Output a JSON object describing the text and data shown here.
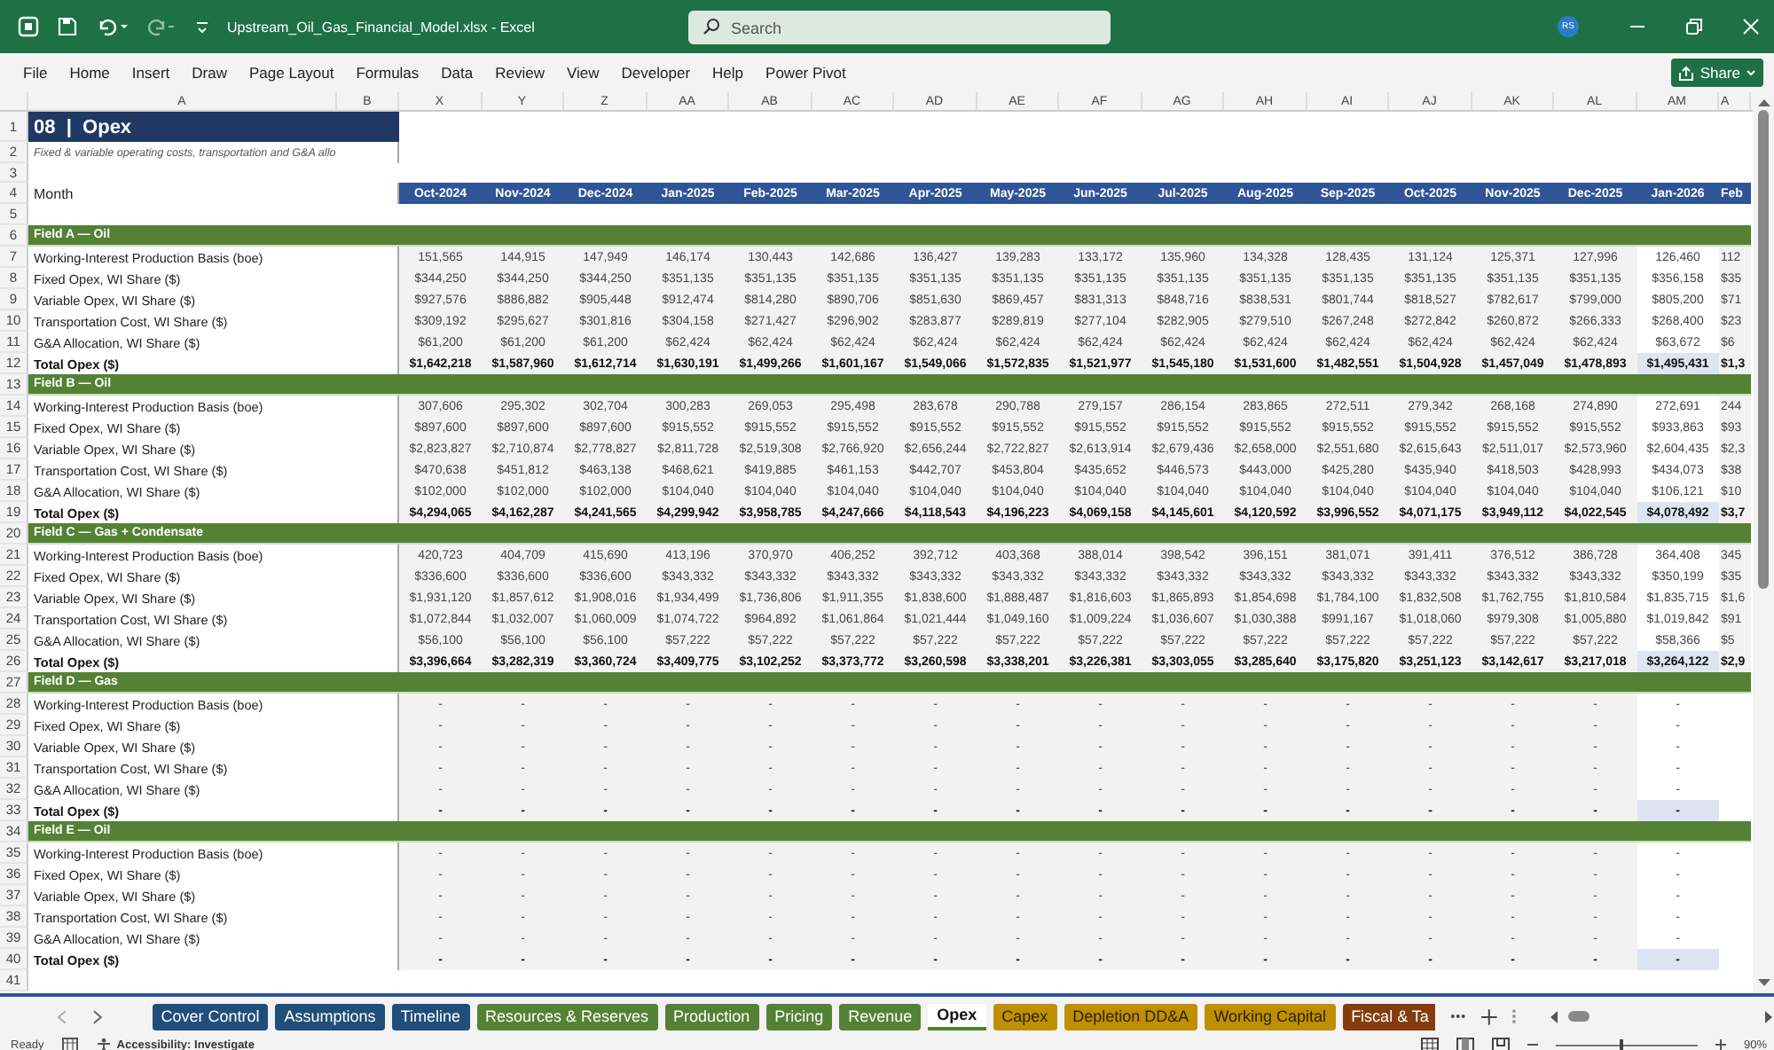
{
  "window": {
    "title": "Upstream_Oil_Gas_Financial_Model.xlsx  -  Excel",
    "search_placeholder": "Search",
    "avatar": "RS"
  },
  "menu": [
    {
      "label": "File"
    },
    {
      "label": "Home"
    },
    {
      "label": "Insert"
    },
    {
      "label": "Draw"
    },
    {
      "label": "Page Layout"
    },
    {
      "label": "Formulas"
    },
    {
      "label": "Data"
    },
    {
      "label": "Review"
    },
    {
      "label": "View"
    },
    {
      "label": "Developer"
    },
    {
      "label": "Help"
    },
    {
      "label": "Power Pivot"
    }
  ],
  "share": "Share",
  "fixed_columns": [
    "A",
    "B"
  ],
  "columns": [
    {
      "letter": "X",
      "month": "Oct-2024",
      "selected": false
    },
    {
      "letter": "Y",
      "month": "Nov-2024",
      "selected": false
    },
    {
      "letter": "Z",
      "month": "Dec-2024",
      "selected": false
    },
    {
      "letter": "AA",
      "month": "Jan-2025",
      "selected": false
    },
    {
      "letter": "AB",
      "month": "Feb-2025",
      "selected": false
    },
    {
      "letter": "AC",
      "month": "Mar-2025",
      "selected": false
    },
    {
      "letter": "AD",
      "month": "Apr-2025",
      "selected": false
    },
    {
      "letter": "AE",
      "month": "May-2025",
      "selected": false
    },
    {
      "letter": "AF",
      "month": "Jun-2025",
      "selected": false
    },
    {
      "letter": "AG",
      "month": "Jul-2025",
      "selected": false
    },
    {
      "letter": "AH",
      "month": "Aug-2025",
      "selected": false
    },
    {
      "letter": "AI",
      "month": "Sep-2025",
      "selected": false
    },
    {
      "letter": "AJ",
      "month": "Oct-2025",
      "selected": false
    },
    {
      "letter": "AK",
      "month": "Nov-2025",
      "selected": false
    },
    {
      "letter": "AL",
      "month": "Dec-2025",
      "selected": false
    },
    {
      "letter": "AM",
      "month": "Jan-2026",
      "selected": true
    },
    {
      "letter": "A",
      "month": "Feb",
      "selected": false
    }
  ],
  "rows": [
    {
      "number": "1",
      "kind": "title",
      "label": "08  |  Opex"
    },
    {
      "number": "2",
      "kind": "subtitle",
      "label": "Fixed & variable operating costs, transportation and G&A allo"
    },
    {
      "number": "3",
      "kind": "blank"
    },
    {
      "number": "4",
      "kind": "header",
      "label": "Month"
    },
    {
      "number": "5",
      "kind": "blank"
    },
    {
      "number": "6",
      "kind": "section",
      "label": "Field A — Oil"
    },
    {
      "number": "7",
      "kind": "item",
      "label": "Working-Interest Production Basis (boe)",
      "values": [
        "151,565",
        "144,915",
        "147,949",
        "146,174",
        "130,443",
        "142,686",
        "136,427",
        "139,283",
        "133,172",
        "135,960",
        "134,328",
        "128,435",
        "131,124",
        "125,371",
        "127,996",
        "126,460",
        "112"
      ]
    },
    {
      "number": "8",
      "kind": "item",
      "label": "Fixed Opex, WI Share ($)",
      "values": [
        "$344,250",
        "$344,250",
        "$344,250",
        "$351,135",
        "$351,135",
        "$351,135",
        "$351,135",
        "$351,135",
        "$351,135",
        "$351,135",
        "$351,135",
        "$351,135",
        "$351,135",
        "$351,135",
        "$351,135",
        "$356,158",
        "$35"
      ]
    },
    {
      "number": "9",
      "kind": "item",
      "label": "Variable Opex, WI Share ($)",
      "values": [
        "$927,576",
        "$886,882",
        "$905,448",
        "$912,474",
        "$814,280",
        "$890,706",
        "$851,630",
        "$869,457",
        "$831,313",
        "$848,716",
        "$838,531",
        "$801,744",
        "$818,527",
        "$782,617",
        "$799,000",
        "$805,200",
        "$71"
      ]
    },
    {
      "number": "10",
      "kind": "item",
      "label": "Transportation Cost, WI Share ($)",
      "values": [
        "$309,192",
        "$295,627",
        "$301,816",
        "$304,158",
        "$271,427",
        "$296,902",
        "$283,877",
        "$289,819",
        "$277,104",
        "$282,905",
        "$279,510",
        "$267,248",
        "$272,842",
        "$260,872",
        "$266,333",
        "$268,400",
        "$23"
      ]
    },
    {
      "number": "11",
      "kind": "item",
      "label": "G&A Allocation, WI Share ($)",
      "values": [
        "$61,200",
        "$61,200",
        "$61,200",
        "$62,424",
        "$62,424",
        "$62,424",
        "$62,424",
        "$62,424",
        "$62,424",
        "$62,424",
        "$62,424",
        "$62,424",
        "$62,424",
        "$62,424",
        "$62,424",
        "$63,672",
        "$6"
      ]
    },
    {
      "number": "12",
      "kind": "total",
      "label": "Total Opex ($)",
      "values": [
        "$1,642,218",
        "$1,587,960",
        "$1,612,714",
        "$1,630,191",
        "$1,499,266",
        "$1,601,167",
        "$1,549,066",
        "$1,572,835",
        "$1,521,977",
        "$1,545,180",
        "$1,531,600",
        "$1,482,551",
        "$1,504,928",
        "$1,457,049",
        "$1,478,893",
        "$1,495,431",
        "$1,3"
      ]
    },
    {
      "number": "13",
      "kind": "section",
      "label": "Field B — Oil"
    },
    {
      "number": "14",
      "kind": "item",
      "label": "Working-Interest Production Basis (boe)",
      "values": [
        "307,606",
        "295,302",
        "302,704",
        "300,283",
        "269,053",
        "295,498",
        "283,678",
        "290,788",
        "279,157",
        "286,154",
        "283,865",
        "272,511",
        "279,342",
        "268,168",
        "274,890",
        "272,691",
        "244"
      ]
    },
    {
      "number": "15",
      "kind": "item",
      "label": "Fixed Opex, WI Share ($)",
      "values": [
        "$897,600",
        "$897,600",
        "$897,600",
        "$915,552",
        "$915,552",
        "$915,552",
        "$915,552",
        "$915,552",
        "$915,552",
        "$915,552",
        "$915,552",
        "$915,552",
        "$915,552",
        "$915,552",
        "$915,552",
        "$933,863",
        "$93"
      ]
    },
    {
      "number": "16",
      "kind": "item",
      "label": "Variable Opex, WI Share ($)",
      "values": [
        "$2,823,827",
        "$2,710,874",
        "$2,778,827",
        "$2,811,728",
        "$2,519,308",
        "$2,766,920",
        "$2,656,244",
        "$2,722,827",
        "$2,613,914",
        "$2,679,436",
        "$2,658,000",
        "$2,551,680",
        "$2,615,643",
        "$2,511,017",
        "$2,573,960",
        "$2,604,435",
        "$2,3"
      ]
    },
    {
      "number": "17",
      "kind": "item",
      "label": "Transportation Cost, WI Share ($)",
      "values": [
        "$470,638",
        "$451,812",
        "$463,138",
        "$468,621",
        "$419,885",
        "$461,153",
        "$442,707",
        "$453,804",
        "$435,652",
        "$446,573",
        "$443,000",
        "$425,280",
        "$435,940",
        "$418,503",
        "$428,993",
        "$434,073",
        "$38"
      ]
    },
    {
      "number": "18",
      "kind": "item",
      "label": "G&A Allocation, WI Share ($)",
      "values": [
        "$102,000",
        "$102,000",
        "$102,000",
        "$104,040",
        "$104,040",
        "$104,040",
        "$104,040",
        "$104,040",
        "$104,040",
        "$104,040",
        "$104,040",
        "$104,040",
        "$104,040",
        "$104,040",
        "$104,040",
        "$106,121",
        "$10"
      ]
    },
    {
      "number": "19",
      "kind": "total",
      "label": "Total Opex ($)",
      "values": [
        "$4,294,065",
        "$4,162,287",
        "$4,241,565",
        "$4,299,942",
        "$3,958,785",
        "$4,247,666",
        "$4,118,543",
        "$4,196,223",
        "$4,069,158",
        "$4,145,601",
        "$4,120,592",
        "$3,996,552",
        "$4,071,175",
        "$3,949,112",
        "$4,022,545",
        "$4,078,492",
        "$3,7"
      ]
    },
    {
      "number": "20",
      "kind": "section",
      "label": "Field C — Gas + Condensate"
    },
    {
      "number": "21",
      "kind": "item",
      "label": "Working-Interest Production Basis (boe)",
      "values": [
        "420,723",
        "404,709",
        "415,690",
        "413,196",
        "370,970",
        "406,252",
        "392,712",
        "403,368",
        "388,014",
        "398,542",
        "396,151",
        "381,071",
        "391,411",
        "376,512",
        "386,728",
        "364,408",
        "345"
      ]
    },
    {
      "number": "22",
      "kind": "item",
      "label": "Fixed Opex, WI Share ($)",
      "values": [
        "$336,600",
        "$336,600",
        "$336,600",
        "$343,332",
        "$343,332",
        "$343,332",
        "$343,332",
        "$343,332",
        "$343,332",
        "$343,332",
        "$343,332",
        "$343,332",
        "$343,332",
        "$343,332",
        "$343,332",
        "$350,199",
        "$35"
      ]
    },
    {
      "number": "23",
      "kind": "item",
      "label": "Variable Opex, WI Share ($)",
      "values": [
        "$1,931,120",
        "$1,857,612",
        "$1,908,016",
        "$1,934,499",
        "$1,736,806",
        "$1,911,355",
        "$1,838,600",
        "$1,888,487",
        "$1,816,603",
        "$1,865,893",
        "$1,854,698",
        "$1,784,100",
        "$1,832,508",
        "$1,762,755",
        "$1,810,584",
        "$1,835,715",
        "$1,6"
      ]
    },
    {
      "number": "24",
      "kind": "item",
      "label": "Transportation Cost, WI Share ($)",
      "values": [
        "$1,072,844",
        "$1,032,007",
        "$1,060,009",
        "$1,074,722",
        "$964,892",
        "$1,061,864",
        "$1,021,444",
        "$1,049,160",
        "$1,009,224",
        "$1,036,607",
        "$1,030,388",
        "$991,167",
        "$1,018,060",
        "$979,308",
        "$1,005,880",
        "$1,019,842",
        "$91"
      ]
    },
    {
      "number": "25",
      "kind": "item",
      "label": "G&A Allocation, WI Share ($)",
      "values": [
        "$56,100",
        "$56,100",
        "$56,100",
        "$57,222",
        "$57,222",
        "$57,222",
        "$57,222",
        "$57,222",
        "$57,222",
        "$57,222",
        "$57,222",
        "$57,222",
        "$57,222",
        "$57,222",
        "$57,222",
        "$58,366",
        "$5"
      ]
    },
    {
      "number": "26",
      "kind": "total",
      "label": "Total Opex ($)",
      "values": [
        "$3,396,664",
        "$3,282,319",
        "$3,360,724",
        "$3,409,775",
        "$3,102,252",
        "$3,373,772",
        "$3,260,598",
        "$3,338,201",
        "$3,226,381",
        "$3,303,055",
        "$3,285,640",
        "$3,175,820",
        "$3,251,123",
        "$3,142,617",
        "$3,217,018",
        "$3,264,122",
        "$2,9"
      ]
    },
    {
      "number": "27",
      "kind": "section",
      "label": "Field D — Gas"
    },
    {
      "number": "28",
      "kind": "item",
      "label": "Working-Interest Production Basis (boe)",
      "values": [
        "-",
        "-",
        "-",
        "-",
        "-",
        "-",
        "-",
        "-",
        "-",
        "-",
        "-",
        "-",
        "-",
        "-",
        "-",
        "-"
      ]
    },
    {
      "number": "29",
      "kind": "item",
      "label": "Fixed Opex, WI Share ($)",
      "values": [
        "-",
        "-",
        "-",
        "-",
        "-",
        "-",
        "-",
        "-",
        "-",
        "-",
        "-",
        "-",
        "-",
        "-",
        "-",
        "-"
      ]
    },
    {
      "number": "30",
      "kind": "item",
      "label": "Variable Opex, WI Share ($)",
      "values": [
        "-",
        "-",
        "-",
        "-",
        "-",
        "-",
        "-",
        "-",
        "-",
        "-",
        "-",
        "-",
        "-",
        "-",
        "-",
        "-"
      ]
    },
    {
      "number": "31",
      "kind": "item",
      "label": "Transportation Cost, WI Share ($)",
      "values": [
        "-",
        "-",
        "-",
        "-",
        "-",
        "-",
        "-",
        "-",
        "-",
        "-",
        "-",
        "-",
        "-",
        "-",
        "-",
        "-"
      ]
    },
    {
      "number": "32",
      "kind": "item",
      "label": "G&A Allocation, WI Share ($)",
      "values": [
        "-",
        "-",
        "-",
        "-",
        "-",
        "-",
        "-",
        "-",
        "-",
        "-",
        "-",
        "-",
        "-",
        "-",
        "-",
        "-"
      ]
    },
    {
      "number": "33",
      "kind": "total",
      "label": "Total Opex ($)",
      "values": [
        "-",
        "-",
        "-",
        "-",
        "-",
        "-",
        "-",
        "-",
        "-",
        "-",
        "-",
        "-",
        "-",
        "-",
        "-",
        "-"
      ]
    },
    {
      "number": "34",
      "kind": "section",
      "label": "Field E — Oil"
    },
    {
      "number": "35",
      "kind": "item",
      "label": "Working-Interest Production Basis (boe)",
      "values": [
        "-",
        "-",
        "-",
        "-",
        "-",
        "-",
        "-",
        "-",
        "-",
        "-",
        "-",
        "-",
        "-",
        "-",
        "-",
        "-"
      ]
    },
    {
      "number": "36",
      "kind": "item",
      "label": "Fixed Opex, WI Share ($)",
      "values": [
        "-",
        "-",
        "-",
        "-",
        "-",
        "-",
        "-",
        "-",
        "-",
        "-",
        "-",
        "-",
        "-",
        "-",
        "-",
        "-"
      ]
    },
    {
      "number": "37",
      "kind": "item",
      "label": "Variable Opex, WI Share ($)",
      "values": [
        "-",
        "-",
        "-",
        "-",
        "-",
        "-",
        "-",
        "-",
        "-",
        "-",
        "-",
        "-",
        "-",
        "-",
        "-",
        "-"
      ]
    },
    {
      "number": "38",
      "kind": "item",
      "label": "Transportation Cost, WI Share ($)",
      "values": [
        "-",
        "-",
        "-",
        "-",
        "-",
        "-",
        "-",
        "-",
        "-",
        "-",
        "-",
        "-",
        "-",
        "-",
        "-",
        "-"
      ]
    },
    {
      "number": "39",
      "kind": "item",
      "label": "G&A Allocation, WI Share ($)",
      "values": [
        "-",
        "-",
        "-",
        "-",
        "-",
        "-",
        "-",
        "-",
        "-",
        "-",
        "-",
        "-",
        "-",
        "-",
        "-",
        "-"
      ]
    },
    {
      "number": "40",
      "kind": "total",
      "label": "Total Opex ($)",
      "values": [
        "-",
        "-",
        "-",
        "-",
        "-",
        "-",
        "-",
        "-",
        "-",
        "-",
        "-",
        "-",
        "-",
        "-",
        "-",
        "-"
      ]
    },
    {
      "number": "41",
      "kind": "blank"
    }
  ],
  "sheet_tabs": [
    {
      "label": "Cover Control",
      "color": "#1f4e79",
      "selected": false
    },
    {
      "label": "Assumptions",
      "color": "#1f4e79",
      "selected": false
    },
    {
      "label": "Timeline",
      "color": "#1f4e79",
      "selected": false
    },
    {
      "label": "Resources & Reserves",
      "color": "#548235",
      "selected": false
    },
    {
      "label": "Production",
      "color": "#548235",
      "selected": false
    },
    {
      "label": "Pricing",
      "color": "#548235",
      "selected": false
    },
    {
      "label": "Revenue",
      "color": "#548235",
      "selected": false
    },
    {
      "label": "Opex",
      "color": "#548235",
      "selected": true
    },
    {
      "label": "Capex",
      "color": "#bf8f00",
      "selected": false
    },
    {
      "label": "Depletion DD&A",
      "color": "#bf8f00",
      "selected": false
    },
    {
      "label": "Working Capital",
      "color": "#bf8f00",
      "selected": false
    },
    {
      "label": "Fiscal & Ta",
      "color": "#843c0c",
      "selected": false
    }
  ],
  "status_bar": {
    "mode": "Ready",
    "accessibility": "Accessibility: Investigate",
    "zoom": "90%",
    "zoom_slider": {
      "level": 0.45
    }
  }
}
